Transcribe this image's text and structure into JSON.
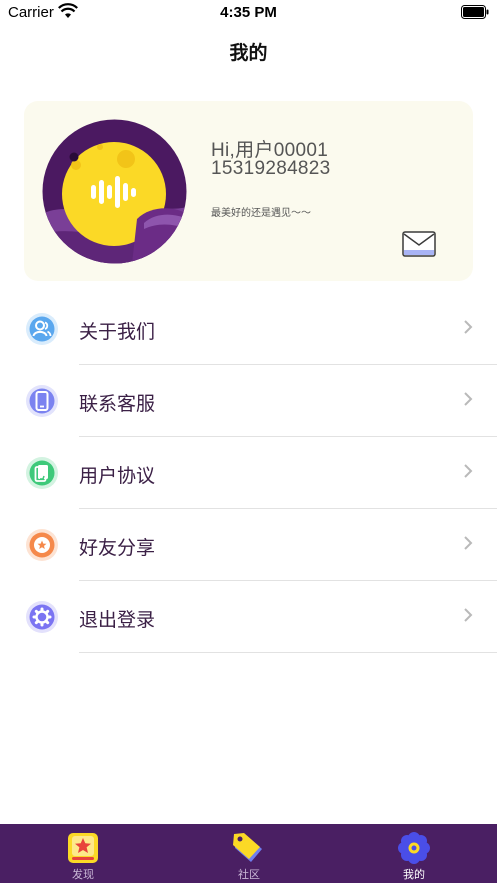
{
  "status_bar": {
    "carrier": "Carrier",
    "time": "4:35 PM"
  },
  "nav": {
    "title": "我的"
  },
  "profile": {
    "greeting": "Hi,用户00001",
    "phone": "15319284823",
    "motto": "最美好的还是遇见～～"
  },
  "menu": {
    "items": [
      {
        "label": "关于我们",
        "icon": "person-icon",
        "color": "#5aa7ee"
      },
      {
        "label": "联系客服",
        "icon": "phone-icon",
        "color": "#7b83f0"
      },
      {
        "label": "用户协议",
        "icon": "document-icon",
        "color": "#3ec97a"
      },
      {
        "label": "好友分享",
        "icon": "star-badge-icon",
        "color": "#f5894b"
      },
      {
        "label": "退出登录",
        "icon": "gear-icon",
        "color": "#7b74f2"
      }
    ]
  },
  "tabbar": {
    "tabs": [
      {
        "label": "发现",
        "icon": "discover-star-icon",
        "active": false
      },
      {
        "label": "社区",
        "icon": "tag-icon",
        "active": false
      },
      {
        "label": "我的",
        "icon": "flower-gear-icon",
        "active": true
      }
    ]
  },
  "colors": {
    "tabbar_bg": "#4a1f63",
    "card_bg": "#fbfaee",
    "avatar_moon": "#fbd926",
    "avatar_bg": "#5a1c6d"
  }
}
